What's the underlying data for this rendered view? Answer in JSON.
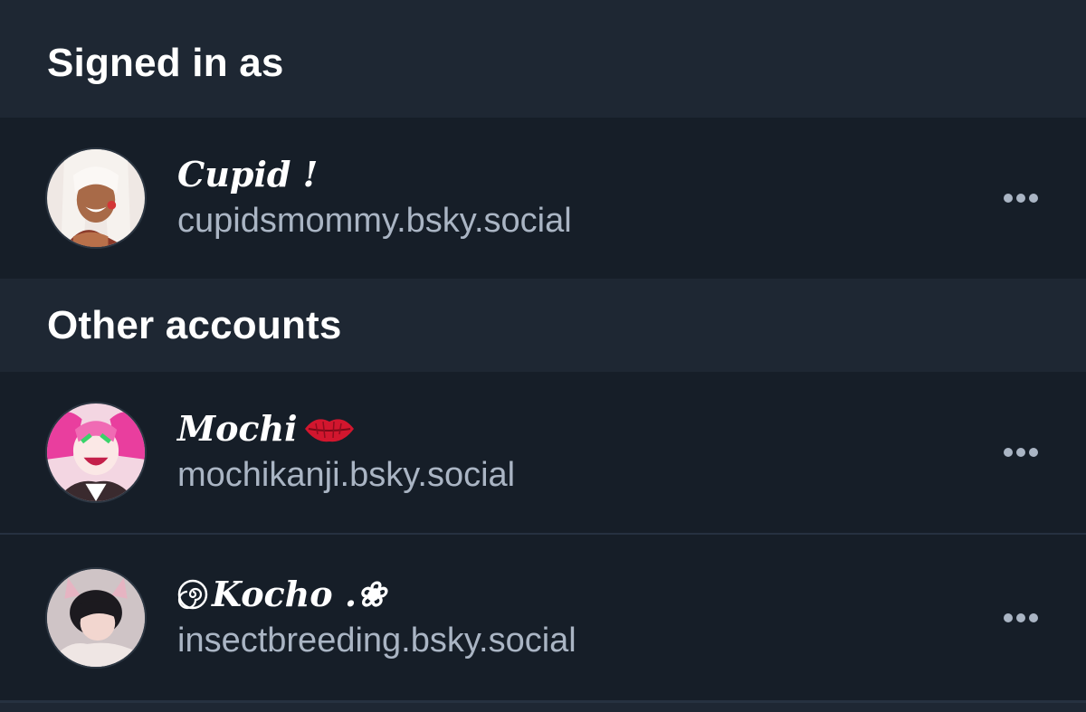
{
  "sections": {
    "signed_in_title": "Signed in as",
    "other_accounts_title": "Other accounts"
  },
  "current_account": {
    "display_name": "Cupid !",
    "handle": "cupidsmommy.bsky.social",
    "avatar": "avatar-illustration"
  },
  "other_accounts": [
    {
      "display_name": "Mochi",
      "name_emoji": "lips-icon",
      "handle": "mochikanji.bsky.social",
      "avatar": "avatar-illustration"
    },
    {
      "display_name": "Kocho .❀",
      "name_prefix_emoji": "spiral-icon",
      "handle": "insectbreeding.bsky.social",
      "avatar": "avatar-illustration"
    }
  ],
  "icons": {
    "more": "more-options-icon"
  },
  "colors": {
    "header_bg": "#1e2733",
    "row_bg": "#161e28",
    "handle_text": "#aab5c4",
    "divider": "#263140"
  }
}
